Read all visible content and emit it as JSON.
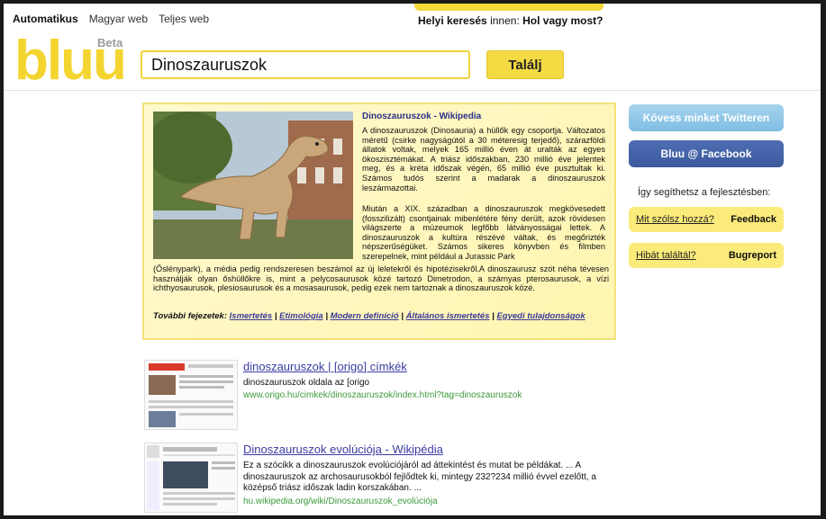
{
  "nav": {
    "items": [
      "Automatikus",
      "Magyar web",
      "Teljes web"
    ],
    "active": "Automatikus"
  },
  "local": {
    "prefix": "Helyi keresés",
    "middle": "innen:",
    "link": "Hol vagy most?"
  },
  "logo": {
    "text": "bluu",
    "beta": "Beta"
  },
  "search": {
    "value": "Dinoszauruszok",
    "button": "Találj"
  },
  "wiki": {
    "title": "Dinoszauruszok - Wikipedia",
    "p1": "A dinoszauruszok (Dinosauria) a hüllők egy csoportja. Változatos méretű (csirke nagyságútól a 30 méteresig terjedő), szárazföldi állatok voltak, melyek 165 millió éven át uralták az egyes ökoszisztémákat. A triász időszakban, 230 millió éve jelentek meg, és a kréta időszak végén, 65 millió éve pusztultak ki. Számos tudós szerint a madarak a dinoszauruszok leszármazottai.",
    "p2": "Miután a XIX. században a dinoszauruszok megkövesedett (fosszilizált) csontjainak mibenlétére fény derült, azok rövidesen világszerte a múzeumok legfőbb látványosságai lettek. A dinoszauruszok a kultúra részévé váltak, és megőrizték népszerűségüket. Számos sikeres könyvben és filmben szerepelnek, mint például a Jurassic Park",
    "p3": "(Őslénypark), a média pedig rendszeresen beszámol az új leletekről és hipotézisekről.A dinoszaurusz szót néha tévesen használják olyan őshüllőkre is, mint a pelycosaurusok közé tartozó Dimetrodon, a szárnyas pterosaurusok, a vízi ichthyosaurusok, plesiosaurusok és a mosasaurusok, pedig ezek nem tartoznak a dinoszauruszok közé.",
    "more_label": "További fejezetek:",
    "more_links": [
      "Ismertetés",
      "Etimológia",
      "Modern definíció",
      "Általános ismertetés",
      "Egyedi tulajdonságok"
    ]
  },
  "sidebar": {
    "twitter": "Kövess minket Twitteren",
    "facebook": "Bluu @ Facebook",
    "help": "Így segíthetsz a fejlesztésben:",
    "fb1_link": "Mit szólsz hozzá?",
    "fb1_label": "Feedback",
    "fb2_link": "Hibát találtál?",
    "fb2_label": "Bugreport"
  },
  "results": [
    {
      "title": "dinoszauruszok | [origo] címkék",
      "desc": "dinoszauruszok oldala az [origo",
      "url": "www.origo.hu/cimkek/dinoszauruszok/index.html?tag=dinoszauruszok"
    },
    {
      "title": "Dinoszauruszok evolúciója - Wikipédia",
      "desc": "Ez a szócikk a dinoszauruszok evolúciójáról ad áttekintést és mutat be példákat. ... A dinoszauruszok az archosaurusokból fejlődtek ki, mintegy 232?234 millió évvel ezelőtt, a középső triász időszak ladin korszakában. ...",
      "url": "hu.wikipedia.org/wiki/Dinoszauruszok_evolúciója"
    }
  ],
  "colors": {
    "accent": "#f4db43",
    "link": "#3b3ba3",
    "url": "#3c9a3c",
    "twitter": "#7fbde3",
    "facebook": "#3c5a9c"
  }
}
